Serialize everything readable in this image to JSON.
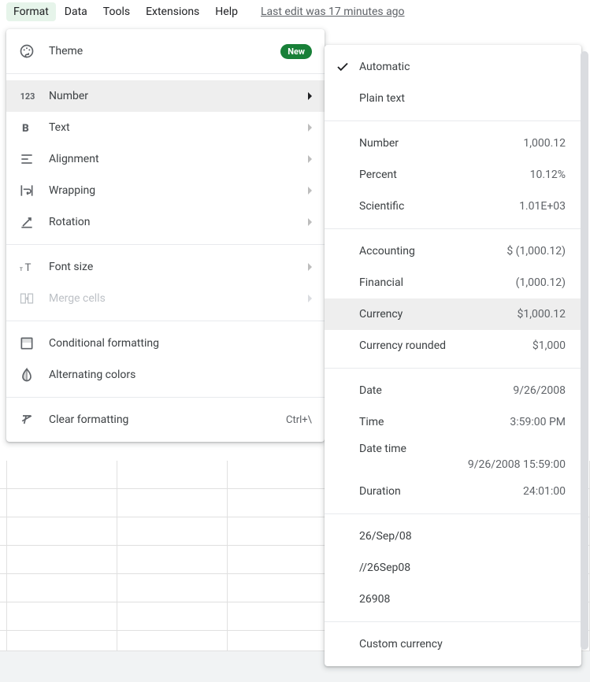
{
  "menubar": {
    "items": [
      "Format",
      "Data",
      "Tools",
      "Extensions",
      "Help"
    ],
    "activeIndex": 0,
    "last_edit": "Last edit was 17 minutes ago"
  },
  "format_menu": {
    "theme": {
      "label": "Theme",
      "badge": "New"
    },
    "number": {
      "label": "Number"
    },
    "text": {
      "label": "Text"
    },
    "alignment": {
      "label": "Alignment"
    },
    "wrapping": {
      "label": "Wrapping"
    },
    "rotation": {
      "label": "Rotation"
    },
    "font_size": {
      "label": "Font size"
    },
    "merge_cells": {
      "label": "Merge cells"
    },
    "conditional_formatting": {
      "label": "Conditional formatting"
    },
    "alternating_colors": {
      "label": "Alternating colors"
    },
    "clear_formatting": {
      "label": "Clear formatting",
      "shortcut": "Ctrl+\\"
    }
  },
  "number_submenu": {
    "automatic": {
      "label": "Automatic"
    },
    "plain_text": {
      "label": "Plain text"
    },
    "number": {
      "label": "Number",
      "sample": "1,000.12"
    },
    "percent": {
      "label": "Percent",
      "sample": "10.12%"
    },
    "scientific": {
      "label": "Scientific",
      "sample": "1.01E+03"
    },
    "accounting": {
      "label": "Accounting",
      "sample": "$ (1,000.12)"
    },
    "financial": {
      "label": "Financial",
      "sample": "(1,000.12)"
    },
    "currency": {
      "label": "Currency",
      "sample": "$1,000.12"
    },
    "currency_rounded": {
      "label": "Currency rounded",
      "sample": "$1,000"
    },
    "date": {
      "label": "Date",
      "sample": "9/26/2008"
    },
    "time": {
      "label": "Time",
      "sample": "3:59:00 PM"
    },
    "date_time": {
      "label": "Date time",
      "sample": "9/26/2008 15:59:00"
    },
    "duration": {
      "label": "Duration",
      "sample": "24:01:00"
    },
    "custom1": {
      "label": "26/Sep/08"
    },
    "custom2": {
      "label": "//26Sep08"
    },
    "custom3": {
      "label": "26908"
    },
    "custom_currency": {
      "label": "Custom currency"
    }
  }
}
